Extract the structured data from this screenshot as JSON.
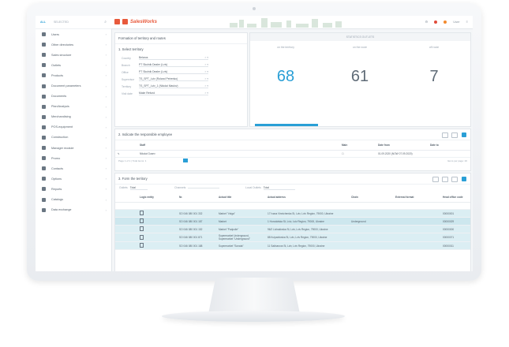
{
  "sidebar": {
    "tabs": [
      {
        "label": "ALL"
      },
      {
        "label": "SELECTED"
      }
    ],
    "items": [
      {
        "label": "Users"
      },
      {
        "label": "Other directories"
      },
      {
        "label": "Sales structure"
      },
      {
        "label": "Outlets"
      },
      {
        "label": "Products"
      },
      {
        "label": "Document parameters"
      },
      {
        "label": "Documents"
      },
      {
        "label": "Plan/Analysis"
      },
      {
        "label": "Merchandising"
      },
      {
        "label": "POS-equipment"
      },
      {
        "label": "Construction"
      },
      {
        "label": "Manager module"
      },
      {
        "label": "Promo"
      },
      {
        "label": "Contacts"
      },
      {
        "label": "Options"
      },
      {
        "label": "Reports"
      },
      {
        "label": "Catalogs"
      },
      {
        "label": "Data exchange"
      }
    ]
  },
  "topbar": {
    "brand": "SalesWorks",
    "user_label": "User"
  },
  "formation": {
    "title": "Formation of territory and routes",
    "section1": "1. Select territory",
    "fields": [
      {
        "label": "Country",
        "value": "Belarus"
      },
      {
        "label": "Branch",
        "value": "PT Skolnik Dealer (Lviv)"
      },
      {
        "label": "Office",
        "value": "PT Skolnik Dealer (Lviv)"
      },
      {
        "label": "Supervisor",
        "value": "TS_SPT_Lviv (Roland Petrenko)"
      },
      {
        "label": "Territory",
        "value": "TS_SPT_Lviv_1 (Nikolai Maslov)"
      },
      {
        "label": "Visit date",
        "value": "Make Refund"
      }
    ]
  },
  "stats": {
    "header": "STATISTICS OUTLETS",
    "items": [
      {
        "label": "on the territory",
        "value": "68"
      },
      {
        "label": "on the route",
        "value": "61"
      },
      {
        "label": "off route",
        "value": "7"
      }
    ]
  },
  "employee": {
    "title": "2. Indicate the responsible employee",
    "columns": [
      "Staff",
      "Main",
      "Date from",
      "Date to"
    ],
    "rows": [
      {
        "staff": "Nikolai Gusev",
        "date_from": "01.09.2020 (NOW 07.09.2020)"
      }
    ],
    "pager": "Page 1 of 1 | Total items: 1",
    "per_page": "Items per page: 20"
  },
  "route": {
    "title": "3. Form the territory",
    "filters": [
      {
        "label": "Outlets",
        "value": "Total"
      },
      {
        "label": "Channels",
        "value": ""
      },
      {
        "label": "Local Outlets",
        "value": "Total"
      }
    ],
    "columns": [
      "Logic entity",
      "Nr.",
      "Actual title",
      "Actual address",
      "Chain",
      "External format",
      "Head office code"
    ],
    "rows": [
      {
        "nr": "SO 046 080 001 332",
        "title": "Market \"Volga\"",
        "address": "17 Ivana Vinnichenka St, Lviv, Lviv Region, 79000, Ukraine",
        "chain": "",
        "code": "00000001"
      },
      {
        "nr": "SO 046 080 001 187",
        "title": "Market",
        "address": "1 Horodotska St, Lviv, Lviv Region, 79000, Ukraine",
        "chain": "Underground",
        "code": "00000029"
      },
      {
        "nr": "SO 046 080 001 152",
        "title": "Market \"Podpolie\"",
        "address": "96/2 Lichakivska St, Lviv, Lviv Region, 79000, Ukraine",
        "chain": "",
        "code": "00000000"
      },
      {
        "nr": "SO 046 080 001 871",
        "title": "Supermarket Underground, Supermarket \"Underground\"",
        "address": "88 Kulparkivska St, Lviv, Lviv Region, 79000, Ukraine",
        "chain": "",
        "code": "00000071"
      },
      {
        "nr": "SO 046 080 001 188",
        "title": "Supermarket \"Sonata\"",
        "address": "11 Sakharova St, Lviv, Lviv Region, 79000, Ukraine",
        "chain": "",
        "code": "00000011"
      }
    ]
  }
}
